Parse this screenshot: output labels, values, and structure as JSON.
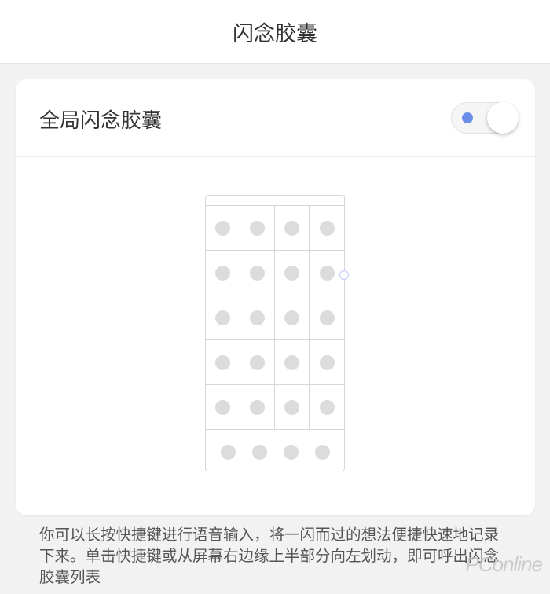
{
  "header": {
    "title": "闪念胶囊"
  },
  "settings": {
    "global_label": "全局闪念胶囊",
    "toggle_state": "off"
  },
  "illustration": {
    "icon_grid_rows": 5,
    "icon_grid_cols": 4,
    "dock_icons": 4
  },
  "description": "你可以长按快捷键进行语音输入，将一闪而过的想法便捷快速地记录下来。单击快捷键或从屏幕右边缘上半部分向左划动，即可呼出闪念胶囊列表",
  "watermark": "PConline",
  "colors": {
    "toggle_dot": "#6b8fe8",
    "background": "#f2f2f2"
  }
}
